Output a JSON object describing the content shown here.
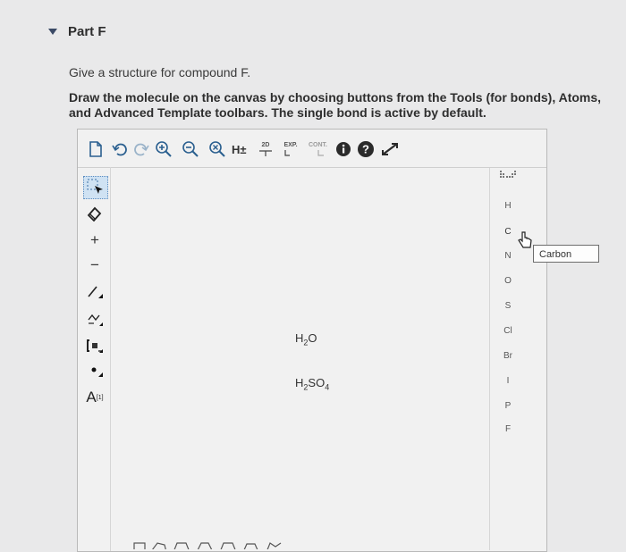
{
  "part": {
    "title": "Part F"
  },
  "question": {
    "prompt": "Give a structure for compound F.",
    "instructions": "Draw the molecule on the canvas by choosing buttons from the Tools (for bonds), Atoms, and Advanced Template toolbars. The single bond is active by default."
  },
  "toolbar": {
    "h_label": "H±",
    "two_d_label": "2D",
    "exp_label": "EXP.",
    "cont_label": "CONT.",
    "help_label": "?"
  },
  "left_toolbar": {
    "plus_label": "+",
    "minus_label": "−",
    "charge_label": "A",
    "charge_sup": "[1]"
  },
  "canvas": {
    "templates": [
      {
        "main": "H",
        "sub": "2",
        "tail": "O"
      },
      {
        "main": "H",
        "sub": "2",
        "tail": "SO",
        "sub2": "4"
      }
    ]
  },
  "atoms": [
    "H",
    "C",
    "N",
    "O",
    "S",
    "Cl",
    "Br",
    "I",
    "P",
    "F"
  ],
  "tooltip": {
    "text": "Carbon"
  }
}
